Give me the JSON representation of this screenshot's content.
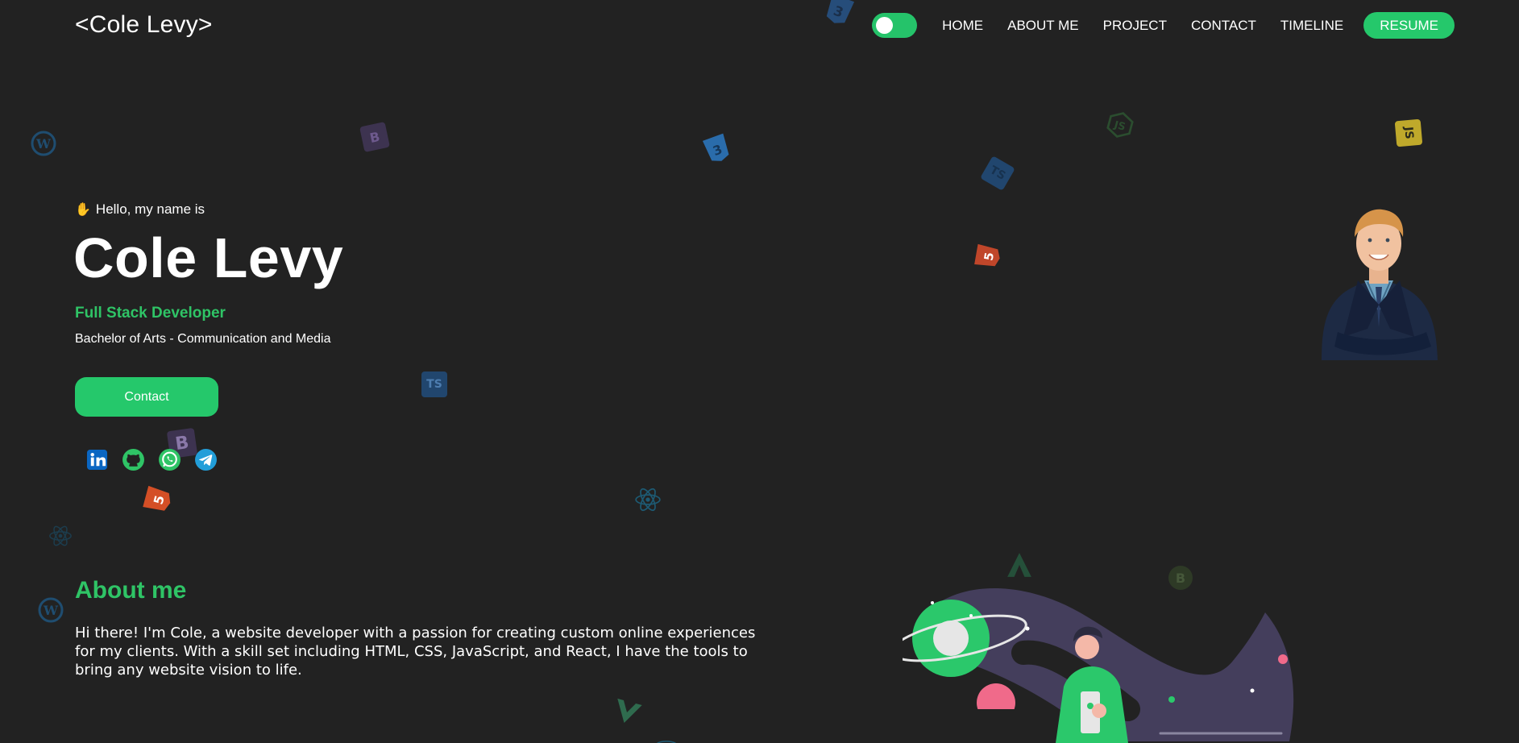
{
  "header": {
    "logo": "<Cole Levy>",
    "theme_toggle": "on",
    "nav": [
      "HOME",
      "ABOUT ME",
      "PROJECT",
      "CONTACT",
      "TIMELINE"
    ],
    "resume_label": "RESUME"
  },
  "hero": {
    "greeting_icon": "waving-hand-icon",
    "greeting": "Hello, my name is",
    "name": "Cole Levy",
    "role": "Full Stack Developer",
    "degree": "Bachelor of Arts - Communication and Media",
    "contact_label": "Contact",
    "socials": [
      "linkedin-icon",
      "github-icon",
      "whatsapp-icon",
      "telegram-icon"
    ]
  },
  "about": {
    "title": "About me",
    "text": "Hi there! I'm Cole, a website developer with a passion for creating custom online experiences for my clients. With a skill set including HTML, CSS, JavaScript, and React, I have the tools to bring any website vision to life."
  },
  "floating_badges": {
    "ts": "TS",
    "bootstrap": "B",
    "js": "JS"
  },
  "colors": {
    "background": "#222222",
    "accent": "#25c86b"
  }
}
